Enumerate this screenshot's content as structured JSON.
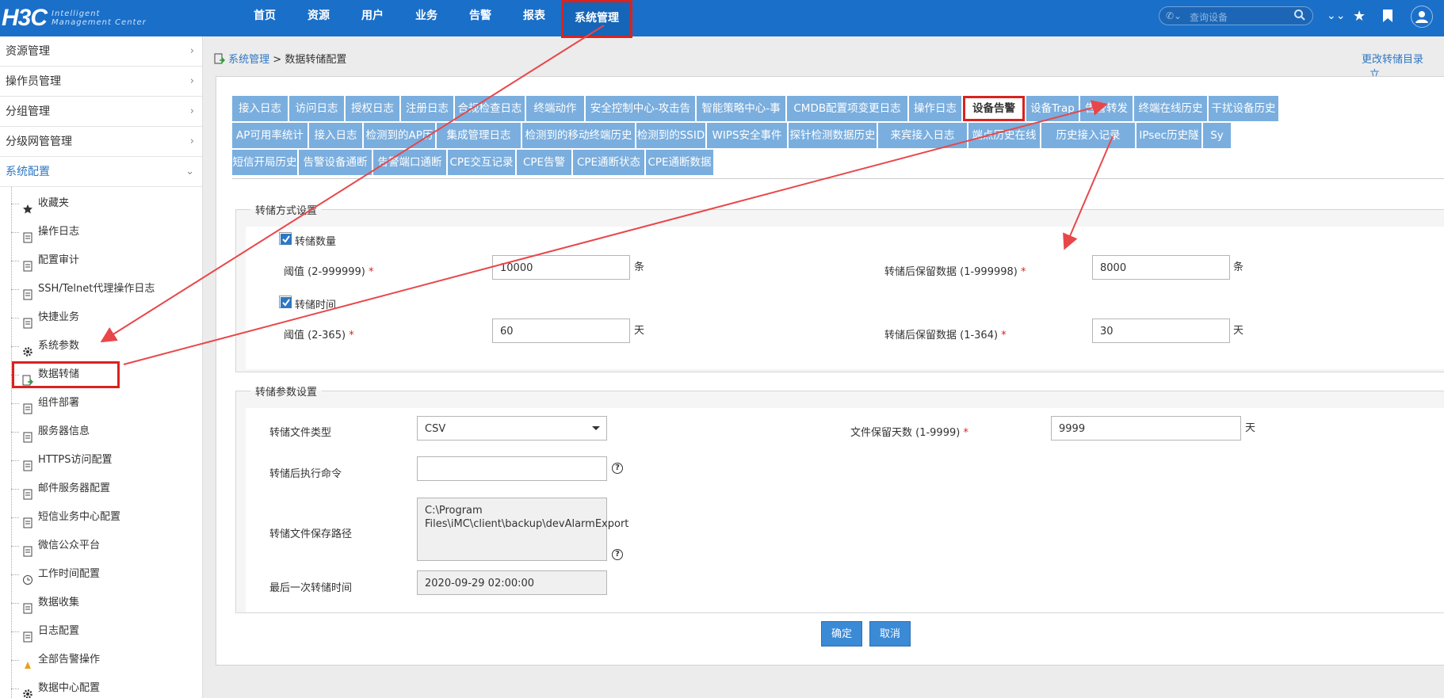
{
  "brand": {
    "logo": "H3C",
    "subtitle_line1": "Intelligent",
    "subtitle_line2": "Management Center"
  },
  "topnav": [
    {
      "label": "首页"
    },
    {
      "label": "资源"
    },
    {
      "label": "用户"
    },
    {
      "label": "业务"
    },
    {
      "label": "告警"
    },
    {
      "label": "报表"
    },
    {
      "label": "系统管理"
    }
  ],
  "search": {
    "placeholder": "查询设备"
  },
  "toolbar_icons": [
    "chevron-double-down-icon",
    "star-icon",
    "bookmark-icon",
    "user-icon"
  ],
  "sidebar": {
    "groups": [
      {
        "label": "资源管理"
      },
      {
        "label": "操作员管理"
      },
      {
        "label": "分组管理"
      },
      {
        "label": "分级网管管理"
      },
      {
        "label": "系统配置"
      }
    ],
    "items": [
      {
        "label": "收藏夹",
        "icon": "star-icon"
      },
      {
        "label": "操作日志",
        "icon": "clipboard-icon"
      },
      {
        "label": "配置审计",
        "icon": "audit-icon"
      },
      {
        "label": "SSH/Telnet代理操作日志",
        "icon": "clipboard-icon"
      },
      {
        "label": "快捷业务",
        "icon": "quick-service-icon"
      },
      {
        "label": "系统参数",
        "icon": "gear-icon"
      },
      {
        "label": "数据转储",
        "icon": "data-dump-icon"
      },
      {
        "label": "组件部署",
        "icon": "component-icon"
      },
      {
        "label": "服务器信息",
        "icon": "server-icon"
      },
      {
        "label": "HTTPS访问配置",
        "icon": "https-icon"
      },
      {
        "label": "邮件服务器配置",
        "icon": "mail-server-icon"
      },
      {
        "label": "短信业务中心配置",
        "icon": "sms-icon"
      },
      {
        "label": "微信公众平台",
        "icon": "wechat-icon"
      },
      {
        "label": "工作时间配置",
        "icon": "clock-icon"
      },
      {
        "label": "数据收集",
        "icon": "data-collect-icon"
      },
      {
        "label": "日志配置",
        "icon": "log-config-icon"
      },
      {
        "label": "全部告警操作",
        "icon": "alarm-icon"
      },
      {
        "label": "数据中心配置",
        "icon": "gear-icon"
      }
    ]
  },
  "breadcrumb": {
    "parent": "系统管理",
    "sep": ">",
    "current": "数据转储配置"
  },
  "top_right_links": {
    "change_dir": "更改转储目录",
    "more": "立"
  },
  "tabs": {
    "row1": [
      "接入日志",
      "访问日志",
      "授权日志",
      "注册日志",
      "合规检查日志",
      "终端动作",
      "安全控制中心-攻击告警",
      "智能策略中心-事件",
      "CMDB配置项变更日志",
      "操作日志",
      "设备告警",
      "设备Trap",
      "告警转发",
      "终端在线历史",
      "干扰设备历史"
    ],
    "row2": [
      "AP可用率统计",
      "接入日志",
      "检测到的AP历史",
      "集成管理日志",
      "检测到的移动终端历史",
      "检测到的SSID历史",
      "WIPS安全事件历史",
      "探针检测数据历史",
      "来宾接入日志",
      "端点历史在线记录",
      "历史接入记录",
      "IPsec历史隧道信息",
      "Sy"
    ],
    "row3": [
      "短信开局历史",
      "告警设备通断",
      "告警端口通断",
      "CPE交互记录",
      "CPE告警",
      "CPE通断状态",
      "CPE通断数据"
    ],
    "selected": "设备告警"
  },
  "dump_mode": {
    "legend": "转储方式设置",
    "by_count": {
      "checkbox_label": "转储数量",
      "checked": true,
      "threshold_label": "阈值 (2-999999)",
      "threshold_value": "10000",
      "threshold_unit": "条",
      "keep_label": "转储后保留数据 (1-999998)",
      "keep_value": "8000",
      "keep_unit": "条"
    },
    "by_time": {
      "checkbox_label": "转储时间",
      "checked": true,
      "threshold_label": "阈值 (2-365)",
      "threshold_value": "60",
      "threshold_unit": "天",
      "keep_label": "转储后保留数据 (1-364)",
      "keep_value": "30",
      "keep_unit": "天"
    },
    "required_mark": "*"
  },
  "dump_params": {
    "legend": "转储参数设置",
    "file_type_label": "转储文件类型",
    "file_type_value": "CSV",
    "file_keep_days_label": "文件保留天数 (1-9999)",
    "file_keep_days_value": "9999",
    "file_keep_days_unit": "天",
    "post_cmd_label": "转储后执行命令",
    "post_cmd_value": "",
    "save_path_label": "转储文件保存路径",
    "save_path_value": "C:\\Program Files\\iMC\\client\\backup\\devAlarmExport",
    "last_time_label": "最后一次转储时间",
    "last_time_value": "2020-09-29 02:00:00",
    "help_glyph": "?"
  },
  "actions": {
    "ok": "确定",
    "cancel": "取消"
  },
  "colors": {
    "topbar": "#1a6fc8",
    "tab": "#7aaede",
    "highlight": "#d9231f",
    "button": "#3b8ad6",
    "link": "#2e77c4"
  }
}
